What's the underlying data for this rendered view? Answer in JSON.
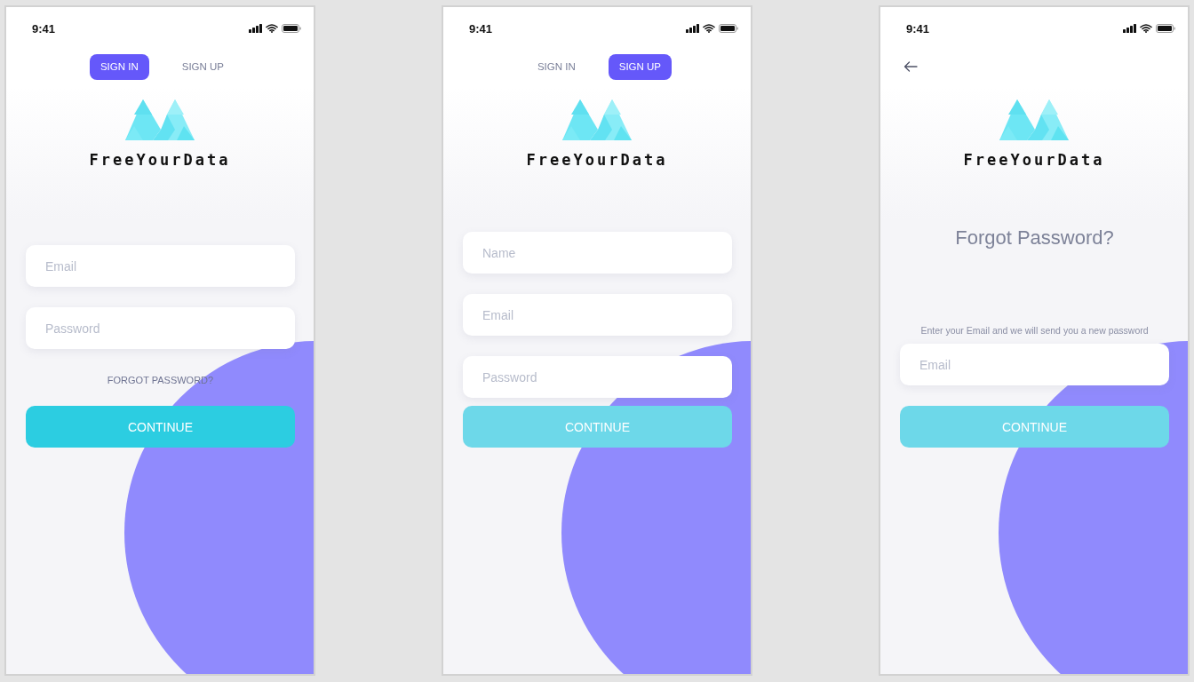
{
  "screens": [
    {
      "status": {
        "time": "9:41"
      },
      "header": {
        "kind": "tabs",
        "tabs": [
          {
            "label": "SIGN IN",
            "selected": true
          },
          {
            "label": "SIGN UP",
            "selected": false
          }
        ]
      },
      "brand": "FreeYourData",
      "fields": [
        {
          "placeholder": "Email"
        },
        {
          "placeholder": "Password"
        }
      ],
      "forgot_link": "FORGOT PASSWORD?",
      "button": {
        "label": "CONTINUE",
        "disabled": false
      }
    },
    {
      "status": {
        "time": "9:41"
      },
      "header": {
        "kind": "tabs",
        "tabs": [
          {
            "label": "SIGN IN",
            "selected": false
          },
          {
            "label": "SIGN UP",
            "selected": true
          }
        ]
      },
      "brand": "FreeYourData",
      "fields": [
        {
          "placeholder": "Name"
        },
        {
          "placeholder": "Email"
        },
        {
          "placeholder": "Password"
        }
      ],
      "button": {
        "label": "CONTINUE",
        "disabled": true
      }
    },
    {
      "status": {
        "time": "9:41"
      },
      "header": {
        "kind": "back"
      },
      "brand": "FreeYourData",
      "title": "Forgot Password?",
      "note": "Enter your Email and we will send you a new password",
      "fields": [
        {
          "placeholder": "Email"
        }
      ],
      "button": {
        "label": "CONTINUE",
        "disabled": true
      }
    }
  ]
}
